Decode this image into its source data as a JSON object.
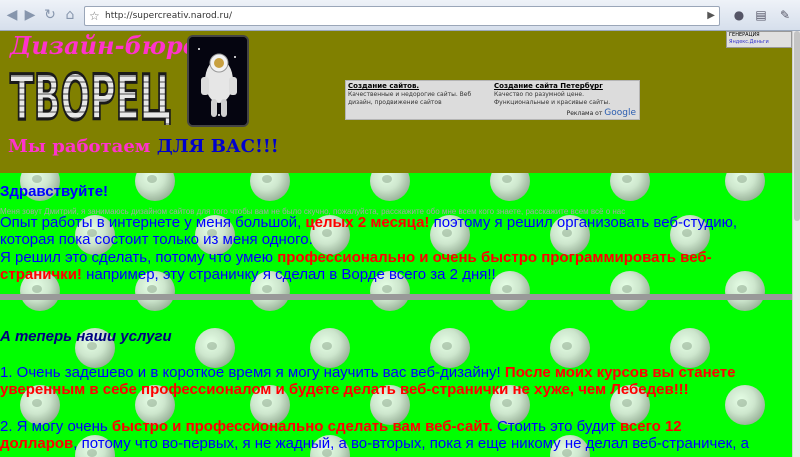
{
  "browser": {
    "url": "http://supercreativ.narod.ru/",
    "back_icon": "back-arrow-icon",
    "forward_icon": "forward-arrow-icon",
    "reload_icon": "reload-icon",
    "home_icon": "home-icon"
  },
  "header": {
    "brand_title": "Дизайн-бюро",
    "logo_text": "ТВОРЕЦ",
    "motto_1": "Мы работаем",
    "motto_2": "ДЛЯ ВАС!!!"
  },
  "ad": {
    "left_title": "Создание сайтов.",
    "left_text": "Качественные и недорогие сайты. Веб дизайн, продвижение сайтов",
    "right_title": "Создание сайта Петербург",
    "right_text": "Качество по разумной цене. Функциональные и красивые сайты.",
    "footer_label": "Реклама от",
    "footer_brand": "Google"
  },
  "widget": {
    "line1": "ГЕНЕРАЦИЯ",
    "line2": "Яндекс.Деньги"
  },
  "content": {
    "greeting": "Здравствуйте!",
    "ghost_text": "Меня зовут Дмитрий, я занимаюсь дизайном сайтов для того чтобы вам не было скучно, пожалуйста, расскажите обо мне всем кого знаете, расскажите всем всё о нас",
    "p1_a": "Опыт работы в интернете у меня большой, ",
    "p1_b": "целых 2 месяца!",
    "p1_c": " поэтому я решил организовать веб-студию, которая пока состоит только из меня одного.",
    "p2_a": "Я решил это сделать, потому что умею ",
    "p2_b": "профессионально и очень быстро программировать веб-странички!",
    "p2_c": " например, эту страничку я сделал в Ворде всего за 2 дня!!",
    "services_title": "А теперь наши услуги",
    "s1_a": "1. Очень задешево и в короткое время я могу научить вас веб-дизайну! ",
    "s1_b": "После моих курсов вы станете уверенным в себе профессионалом и будете делать веб-странички не хуже, чем Лебедев",
    "s1_c": "!!!",
    "s2_a": "2. Я могу очень ",
    "s2_b": "быстро и профессионально сделать вам веб-сайт.",
    "s2_c": " Стоить это будит ",
    "s2_d": "всего 12 долларов",
    "s2_e": ", потому что во-первых, я не жадный, а во-вторых, пока я еще никому не делал веб-страничек, а если вы"
  }
}
